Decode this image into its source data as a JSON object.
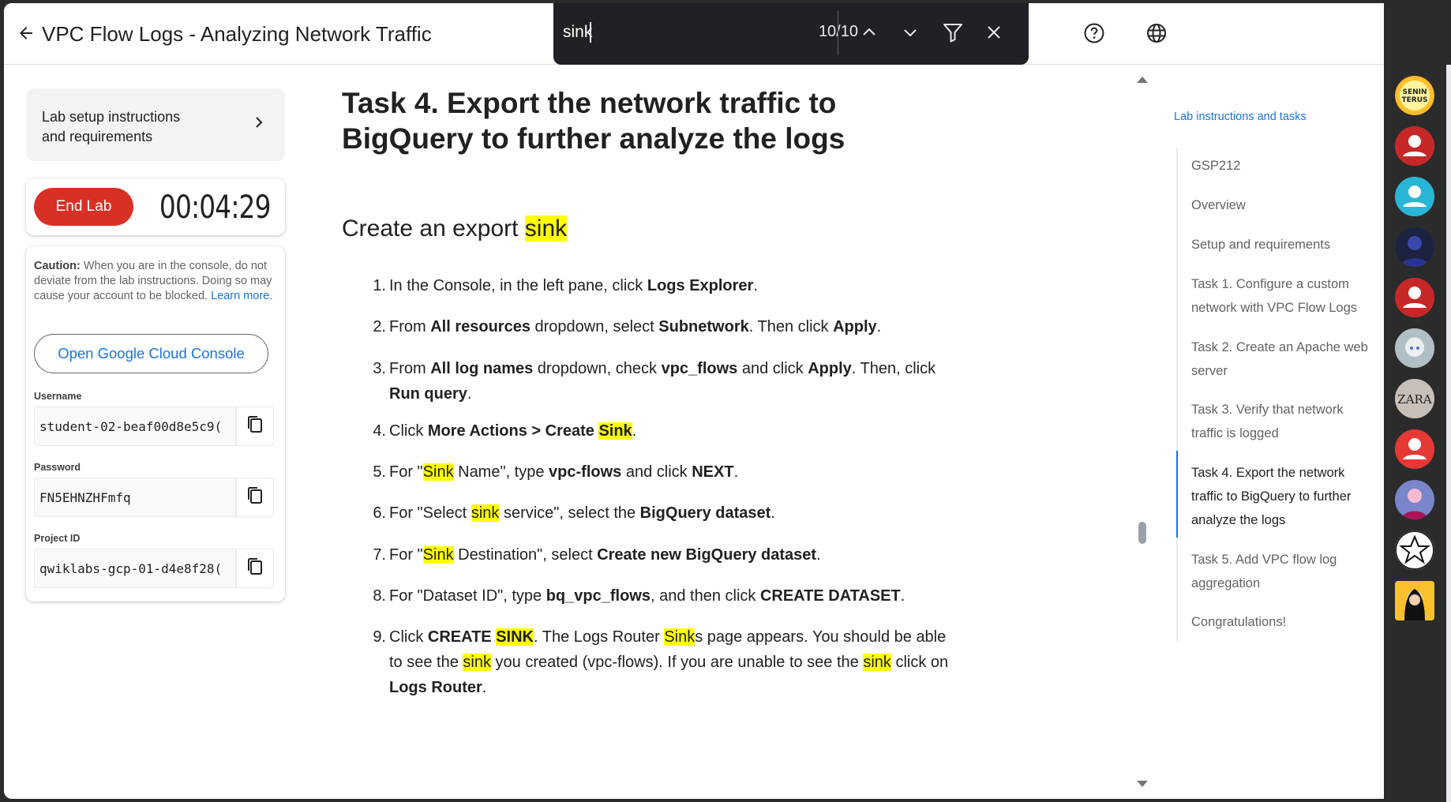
{
  "header": {
    "title": "VPC Flow Logs - Analyzing Network Traffic"
  },
  "findbar": {
    "query": "sink",
    "count": "10/10"
  },
  "left_panel": {
    "setup_label_line1": "Lab setup instructions",
    "setup_label_line2": "and requirements",
    "end_lab_label": "End Lab",
    "timer": "00:04:29",
    "caution_bold": "Caution:",
    "caution_text": " When you are in the console, do not deviate from the lab instructions. Doing so may cause your account to be blocked. ",
    "learn_more": "Learn more.",
    "open_console_label": "Open Google Cloud Console",
    "username_label": "Username",
    "username_value": "student-02-beaf00d8e5c9(",
    "password_label": "Password",
    "password_value": "FN5EHNZHFmfq",
    "project_label": "Project ID",
    "project_value": "qwiklabs-gcp-01-d4e8f28("
  },
  "content": {
    "task_title": "Task 4. Export the network traffic to BigQuery to further analyze the logs",
    "section_prefix": "Create an export ",
    "section_highlight": "sink"
  },
  "toc": {
    "header": "Lab instructions and tasks",
    "items": [
      "GSP212",
      "Overview",
      "Setup and requirements",
      "Task 1. Configure a custom network with VPC Flow Logs",
      "Task 2. Create an Apache web server",
      "Task 3. Verify that network traffic is logged",
      "Task 4. Export the network traffic to BigQuery to further analyze the logs",
      "Task 5. Add VPC flow log aggregation",
      "Congratulations!"
    ]
  },
  "rail": {
    "avatar1_line1": "SENIN",
    "avatar1_line2": "TERUS",
    "avatar_zara": "ZARA"
  },
  "colors": {
    "accent": "#1a73e8",
    "end_lab": "#d93025",
    "highlight": "#ffff00",
    "findbar_bg": "#202124"
  },
  "icons": [
    "back-arrow-icon",
    "help-icon",
    "globe-icon",
    "chevron-up-icon",
    "chevron-down-icon",
    "filter-icon",
    "close-icon",
    "chevron-right-icon",
    "copy-icon"
  ]
}
